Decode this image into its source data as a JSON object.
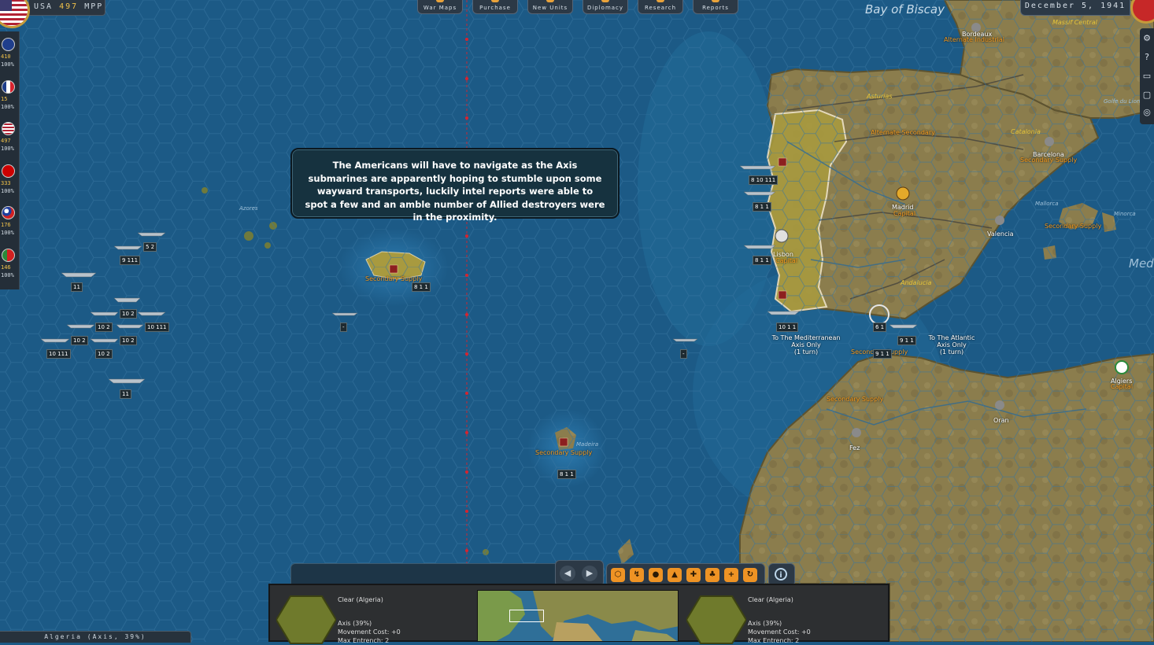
{
  "header": {
    "nation": "USA",
    "mpp_value": "497",
    "mpp_unit": "MPP",
    "date": "December 5, 1941"
  },
  "top_buttons": [
    "War Maps",
    "Purchase",
    "New Units",
    "Diplomacy",
    "Research",
    "Reports"
  ],
  "nations": [
    {
      "name": "uk-flag",
      "mpp": "410",
      "readiness": "100%",
      "color": "#1f3e8c"
    },
    {
      "name": "france-flag",
      "mpp": "15",
      "readiness": "100%",
      "color": "#ffffff"
    },
    {
      "name": "usa-flag",
      "mpp": "497",
      "readiness": "100%",
      "color": "#b22234"
    },
    {
      "name": "ussr-flag",
      "mpp": "333",
      "readiness": "100%",
      "color": "#cc0000"
    },
    {
      "name": "china-flag",
      "mpp": "176",
      "readiness": "100%",
      "color": "#1e3e9e"
    },
    {
      "name": "portugal-flag",
      "mpp": "146",
      "readiness": "100%",
      "color": "#d32020"
    }
  ],
  "side_tools": [
    "gear-icon",
    "help-icon",
    "save-icon",
    "chat-icon",
    "globe-icon"
  ],
  "message": "The Americans will have to navigate as the Axis submarines are apparently hoping to stumble upon some wayward transports, luckily intel reports were able to spot a few and an amble number of Allied destroyers were in the proximity.",
  "map": {
    "sea_labels": [
      "Bay of Biscay",
      "Med",
      "Azores",
      "Madeira",
      "Golfe du Lion",
      "Mallorca",
      "Minorca"
    ],
    "regions": [
      "Massif Central",
      "Asturias",
      "Catalonia",
      "Andalucia"
    ],
    "cities": [
      {
        "name": "Bordeaux",
        "tag": "Alternate Industrial"
      },
      {
        "name": "Madrid",
        "tag": "Capital"
      },
      {
        "name": "Lisbon",
        "tag": "Capital"
      },
      {
        "name": "Barcelona",
        "tag": "Secondary Supply"
      },
      {
        "name": "Valencia",
        "tag": ""
      },
      {
        "name": "Fez",
        "tag": ""
      },
      {
        "name": "Algiers",
        "tag": "Capital"
      },
      {
        "name": "Oran",
        "tag": ""
      }
    ],
    "supply_labels": [
      "Secondary Supply",
      "Secondary Supply",
      "Secondary Supply",
      "Secondary Supply",
      "Secondary Supply",
      "Alternate Secondary"
    ],
    "transit": [
      {
        "line1": "To The Mediterranean",
        "line2": "Axis Only",
        "line3": "(1 turn)"
      },
      {
        "line1": "To The Atlantic",
        "line2": "Axis Only",
        "line3": "(1 turn)"
      }
    ],
    "units": [
      {
        "label": "5 2"
      },
      {
        "label": "9 111"
      },
      {
        "label": "11"
      },
      {
        "label": "10 2"
      },
      {
        "label": "10 111"
      },
      {
        "label": "10 2"
      },
      {
        "label": "10 2"
      },
      {
        "label": "10 111"
      },
      {
        "label": "10 2"
      },
      {
        "label": "10 2"
      },
      {
        "label": "11"
      },
      {
        "label": "8 1 1"
      },
      {
        "label": "-"
      },
      {
        "label": "-"
      },
      {
        "label": "8 1 1"
      },
      {
        "label": "8 10 111"
      },
      {
        "label": "8 1 1"
      },
      {
        "label": "8 1 1"
      },
      {
        "label": "10 1 1"
      },
      {
        "label": "6 1"
      },
      {
        "label": "9 1 1"
      },
      {
        "label": "9 1 1"
      }
    ]
  },
  "info_panel": {
    "left": {
      "terrain": "Clear (Algeria)",
      "owner": "Axis (39%)",
      "movement": "Movement Cost: +0",
      "entrench": "Max Entrench: 2"
    },
    "right": {
      "terrain": "Clear (Algeria)",
      "owner": "Axis (39%)",
      "movement": "Movement Cost: +0",
      "entrench": "Max Entrench: 2"
    }
  },
  "filters": [
    "hex-filter-icon",
    "supply-filter-icon",
    "resource-filter-icon",
    "unit-filter-icon",
    "cross-filter-icon",
    "terrain-filter-icon",
    "plus-filter-icon",
    "loop-filter-icon"
  ],
  "status_bar": "Algeria (Axis, 39%)",
  "colors": {
    "ocean": "#1c5a86",
    "land": "#8a7c4c",
    "portugal": "#a79a3e",
    "accent": "#ee9324",
    "supply_text": "#f59a1e"
  }
}
